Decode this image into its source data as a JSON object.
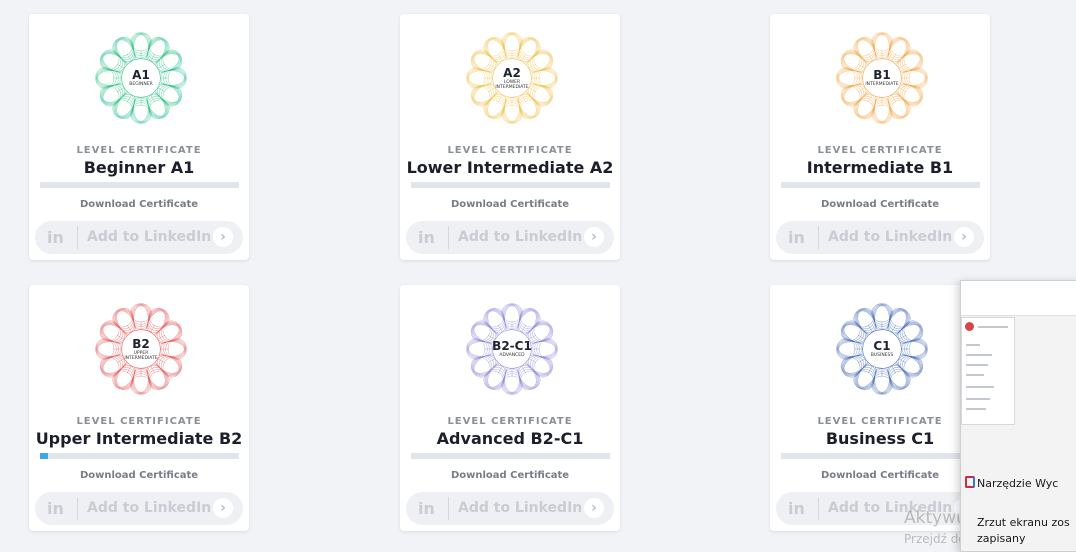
{
  "cards": [
    {
      "code": "A1",
      "sub": "BEGINNER",
      "kicker": "LEVEL CERTIFICATE",
      "title": "Beginner A1",
      "progress": 0,
      "download": "Download Certificate",
      "linkedin": "Add to LinkedIn",
      "li_icon": "in",
      "arrow": "›",
      "color": "#2fc28a"
    },
    {
      "code": "A2",
      "sub": "LOWER INTERMEDIATE",
      "kicker": "LEVEL CERTIFICATE",
      "title": "Lower Intermediate A2",
      "progress": 0,
      "download": "Download Certificate",
      "linkedin": "Add to LinkedIn",
      "li_icon": "in",
      "arrow": "›",
      "color": "#f0c24d"
    },
    {
      "code": "B1",
      "sub": "INTERMEDIATE",
      "kicker": "LEVEL CERTIFICATE",
      "title": "Intermediate B1",
      "progress": 0,
      "download": "Download Certificate",
      "linkedin": "Add to LinkedIn",
      "li_icon": "in",
      "arrow": "›",
      "color": "#f3a84a"
    },
    {
      "code": "B2",
      "sub": "UPPER INTERMEDIATE",
      "kicker": "LEVEL CERTIFICATE",
      "title": "Upper Intermediate B2",
      "progress": 0.04,
      "download": "Download Certificate",
      "linkedin": "Add to LinkedIn",
      "li_icon": "in",
      "arrow": "›",
      "color": "#e35d5d"
    },
    {
      "code": "B2-C1",
      "sub": "ADVANCED",
      "kicker": "LEVEL CERTIFICATE",
      "title": "Advanced B2-C1",
      "progress": 0,
      "download": "Download Certificate",
      "linkedin": "Add to LinkedIn",
      "li_icon": "in",
      "arrow": "›",
      "color": "#8e86d8"
    },
    {
      "code": "C1",
      "sub": "BUSINESS",
      "kicker": "LEVEL CERTIFICATE",
      "title": "Business C1",
      "progress": 0,
      "download": "Download Certificate",
      "linkedin": "Add to LinkedIn",
      "li_icon": "in",
      "arrow": "›",
      "color": "#4a6fb8"
    }
  ],
  "snip": {
    "app_name": "Narzędzie Wyc",
    "message": "Zrzut ekranu zos zapisany"
  },
  "watermark": {
    "line1": "Aktywuj system Wi",
    "line2": "Przejdź do ustawień, aby a"
  }
}
